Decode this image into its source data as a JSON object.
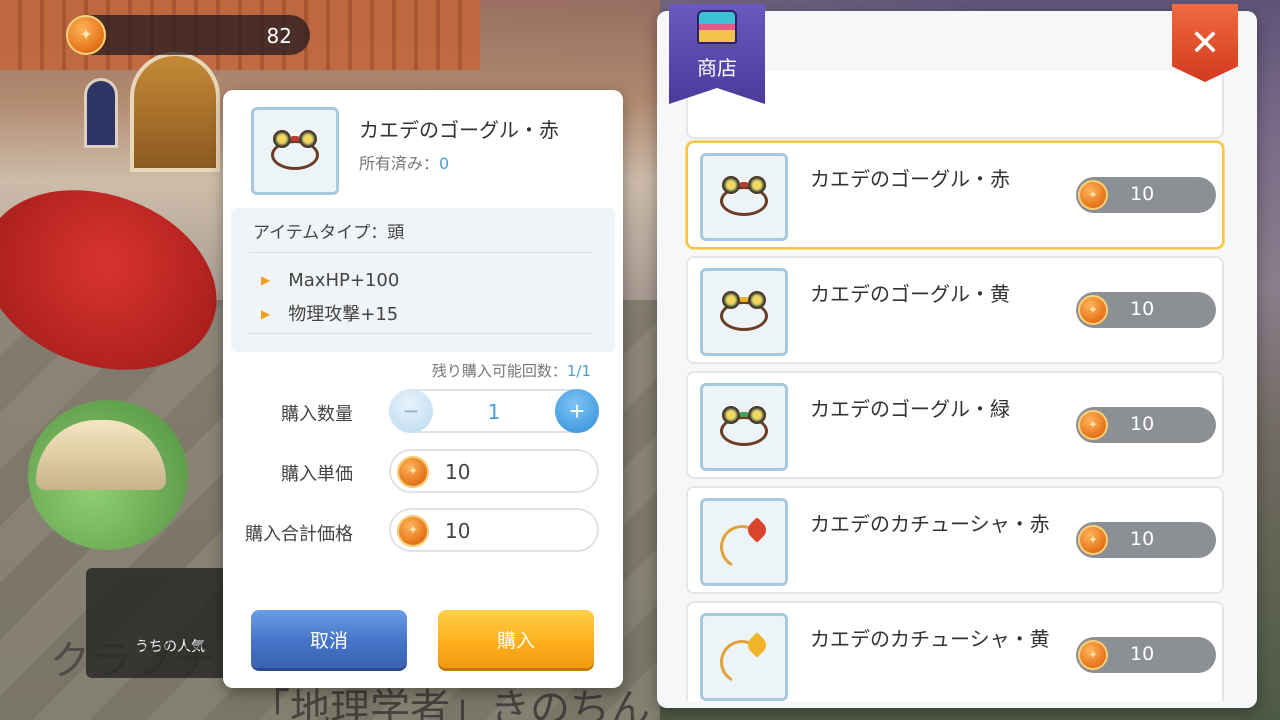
{
  "currency": {
    "icon": "maple-coin-icon",
    "amount": "82"
  },
  "detail": {
    "item_name": "カエデのゴーグル・赤",
    "owned_label": "所有済み：",
    "owned_value": "0",
    "item_type": "アイテムタイプ：頭",
    "stats": [
      "MaxHP+100",
      "物理攻撃+15"
    ],
    "remaining_label": "残り購入可能回数：",
    "remaining_value": "1/1",
    "quantity_label": "購入数量",
    "quantity_value": "1",
    "unit_price_label": "購入単価",
    "unit_price_value": "10",
    "total_price_label": "購入合計価格",
    "total_price_value": "10",
    "cancel_label": "取消",
    "buy_label": "購入",
    "minus_symbol": "−",
    "plus_symbol": "+"
  },
  "shop": {
    "title": "商店",
    "close_symbol": "✕",
    "items": [
      {
        "name": "カエデのゴーグル・赤",
        "price": "10",
        "icon": "goggle-red-icon",
        "accent": "#c0392b"
      },
      {
        "name": "カエデのゴーグル・黄",
        "price": "10",
        "icon": "goggle-yellow-icon",
        "accent": "#e6b422"
      },
      {
        "name": "カエデのゴーグル・緑",
        "price": "10",
        "icon": "goggle-green-icon",
        "accent": "#3aa34a"
      },
      {
        "name": "カエデのカチューシャ・赤",
        "price": "10",
        "icon": "headband-red-icon",
        "accent": "#d8452a"
      },
      {
        "name": "カエデのカチューシャ・黄",
        "price": "10",
        "icon": "headband-yellow-icon",
        "accent": "#f0b42a"
      }
    ]
  },
  "background": {
    "chat_snippet": "うちの人気",
    "name_fragment_1": "クラブチ",
    "name_fragment_2": "「地理学者」きのちん"
  },
  "colors": {
    "accent_blue": "#4aa0d6",
    "buy_orange": "#ffb01e",
    "cancel_blue": "#4574c8",
    "selected_border": "#f4c64a"
  }
}
